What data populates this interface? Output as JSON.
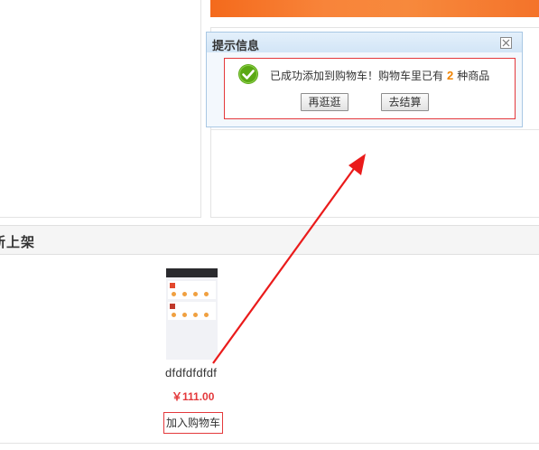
{
  "dialog": {
    "title": "提示信息",
    "close_icon": "close-icon",
    "success_icon": "check-circle-icon",
    "message_prefix": "已成功添加到购物车！购物车里已有",
    "cart_count": "2",
    "message_suffix": "种商品",
    "continue_label": "再逛逛",
    "checkout_label": "去结算"
  },
  "section": {
    "title": "新上架"
  },
  "product": {
    "name": "dfdfdfdfdf",
    "price": "￥111.00",
    "add_to_cart_label": "加入购物车"
  },
  "colors": {
    "accent_red": "#e4393c",
    "count_orange": "#f08300",
    "banner_orange": "#f4732a",
    "dialog_header_blue": "#d2e5f6",
    "success_green": "#5aa814"
  }
}
